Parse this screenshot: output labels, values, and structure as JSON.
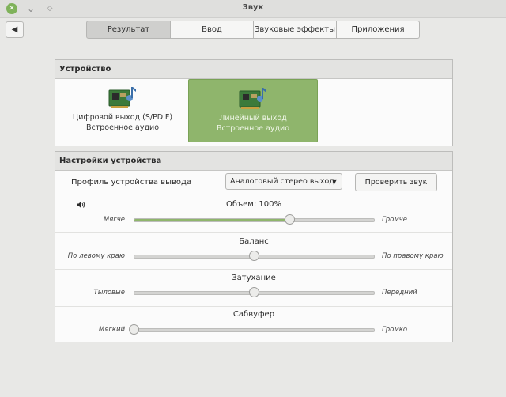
{
  "window": {
    "title": "Звук"
  },
  "titlebar": {
    "close_glyph": "✕",
    "min_glyph": "⌄",
    "max_glyph": "◇"
  },
  "toolbar": {
    "back_glyph": "◀"
  },
  "tabs": [
    {
      "label": "Результат",
      "active": true
    },
    {
      "label": "Ввод",
      "active": false
    },
    {
      "label": "Звуковые эффекты",
      "active": false
    },
    {
      "label": "Приложения",
      "active": false
    }
  ],
  "device_section": {
    "header": "Устройство",
    "devices": [
      {
        "name": "Цифровой выход (S/PDIF)",
        "subtitle": "Встроенное аудио",
        "icon": "audio-card-icon",
        "selected": false
      },
      {
        "name": "Линейный выход",
        "subtitle": "Встроенное аудио",
        "icon": "audio-card-icon",
        "selected": true
      }
    ]
  },
  "settings_section": {
    "header": "Настройки устройства",
    "profile_label": "Профиль устройства вывода",
    "profile_value": "Аналоговый стерео выход",
    "test_button": "Проверить звук",
    "sliders": [
      {
        "title": "Объем: 100%",
        "left": "Мягче",
        "right": "Громче",
        "value": 0.65,
        "filled": true
      },
      {
        "title": "Баланс",
        "left": "По левому краю",
        "right": "По правому краю",
        "value": 0.5,
        "filled": false
      },
      {
        "title": "Затухание",
        "left": "Тыловые",
        "right": "Передний",
        "value": 0.5,
        "filled": false
      },
      {
        "title": "Сабвуфер",
        "left": "Мягкий",
        "right": "Громко",
        "value": 0.0,
        "filled": false
      }
    ]
  },
  "colors": {
    "accent": "#8fb56c",
    "background": "#e8e8e6"
  }
}
